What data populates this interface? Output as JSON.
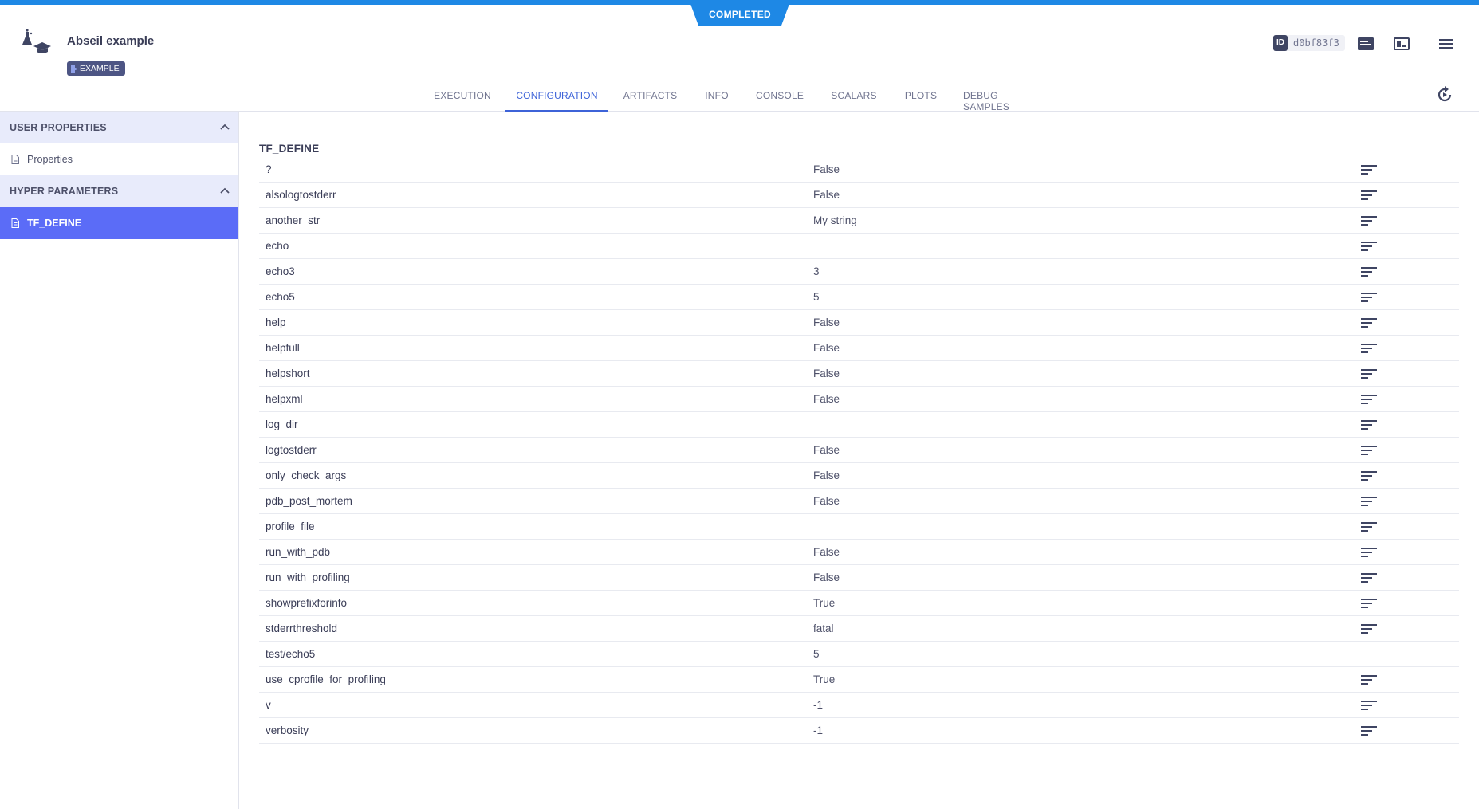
{
  "status": "COMPLETED",
  "experiment": {
    "title": "Abseil example",
    "tag": "EXAMPLE",
    "id_label": "ID",
    "id_value": "d0bf83f3"
  },
  "tabs": [
    {
      "label": "EXECUTION",
      "active": false
    },
    {
      "label": "CONFIGURATION",
      "active": true
    },
    {
      "label": "ARTIFACTS",
      "active": false
    },
    {
      "label": "INFO",
      "active": false
    },
    {
      "label": "CONSOLE",
      "active": false
    },
    {
      "label": "SCALARS",
      "active": false
    },
    {
      "label": "PLOTS",
      "active": false
    },
    {
      "label": "DEBUG SAMPLES",
      "active": false
    }
  ],
  "sidebar": {
    "user_properties": {
      "title": "USER PROPERTIES",
      "item": "Properties"
    },
    "hyper_parameters": {
      "title": "HYPER PARAMETERS",
      "item": "TF_DEFINE"
    }
  },
  "section": {
    "title": "TF_DEFINE",
    "rows": [
      {
        "name": "?",
        "value": "False",
        "desc": true
      },
      {
        "name": "alsologtostderr",
        "value": "False",
        "desc": true
      },
      {
        "name": "another_str",
        "value": "My string",
        "desc": true
      },
      {
        "name": "echo",
        "value": "",
        "desc": true
      },
      {
        "name": "echo3",
        "value": "3",
        "desc": true
      },
      {
        "name": "echo5",
        "value": "5",
        "desc": true
      },
      {
        "name": "help",
        "value": "False",
        "desc": true
      },
      {
        "name": "helpfull",
        "value": "False",
        "desc": true
      },
      {
        "name": "helpshort",
        "value": "False",
        "desc": true
      },
      {
        "name": "helpxml",
        "value": "False",
        "desc": true
      },
      {
        "name": "log_dir",
        "value": "",
        "desc": true
      },
      {
        "name": "logtostderr",
        "value": "False",
        "desc": true
      },
      {
        "name": "only_check_args",
        "value": "False",
        "desc": true
      },
      {
        "name": "pdb_post_mortem",
        "value": "False",
        "desc": true
      },
      {
        "name": "profile_file",
        "value": "",
        "desc": true
      },
      {
        "name": "run_with_pdb",
        "value": "False",
        "desc": true
      },
      {
        "name": "run_with_profiling",
        "value": "False",
        "desc": true
      },
      {
        "name": "showprefixforinfo",
        "value": "True",
        "desc": true
      },
      {
        "name": "stderrthreshold",
        "value": "fatal",
        "desc": true
      },
      {
        "name": "test/echo5",
        "value": "5",
        "desc": false
      },
      {
        "name": "use_cprofile_for_profiling",
        "value": "True",
        "desc": true
      },
      {
        "name": "v",
        "value": "-1",
        "desc": true
      },
      {
        "name": "verbosity",
        "value": "-1",
        "desc": true
      }
    ]
  },
  "colors": {
    "accent": "#3d63d8",
    "status": "#1e88e5",
    "sidebar_active": "#5b6cf7",
    "section_header": "#e8ebfb"
  },
  "icons": {
    "experiment": "experiment-icon",
    "tag": "puzzle-icon",
    "details_panel": "details-panel-icon",
    "layout": "layout-icon",
    "menu": "hamburger-menu-icon",
    "refresh": "refresh-icon",
    "collapse": "chevron-up-icon",
    "document": "document-icon",
    "description": "description-icon"
  }
}
